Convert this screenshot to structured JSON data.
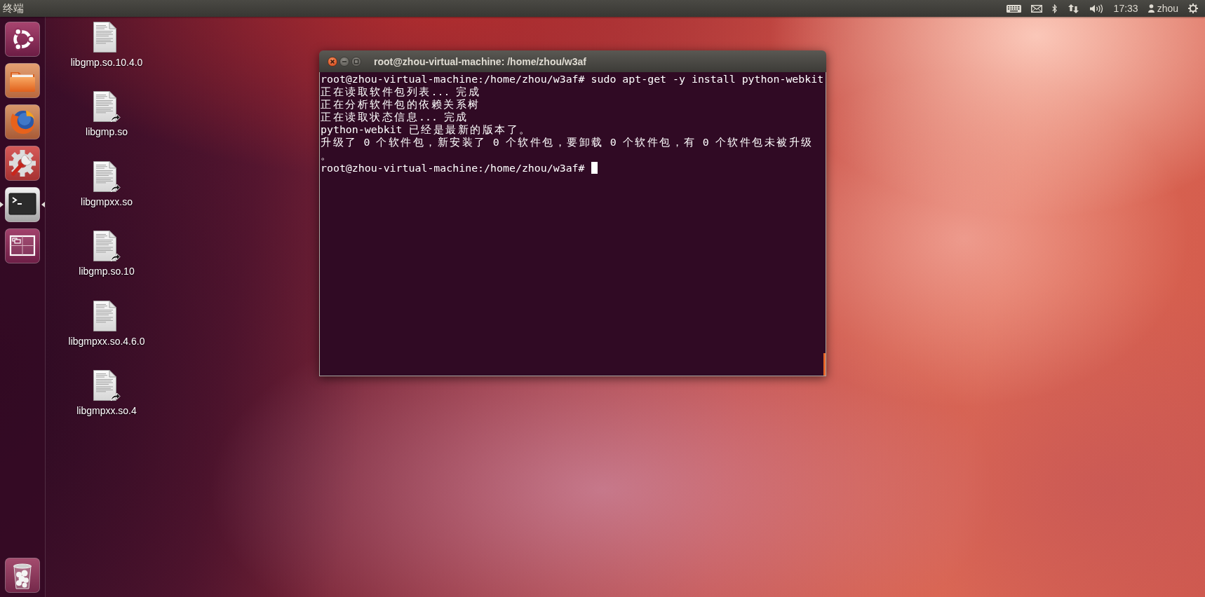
{
  "top_bar": {
    "title": "终端",
    "clock": "17:33",
    "user": "zhou"
  },
  "launcher": {
    "items": [
      {
        "kind": "dash",
        "running": false,
        "focused": false
      },
      {
        "kind": "files",
        "running": false,
        "focused": false
      },
      {
        "kind": "browser",
        "running": false,
        "focused": false
      },
      {
        "kind": "settings",
        "running": false,
        "focused": false
      },
      {
        "kind": "terminal",
        "running": true,
        "focused": true
      },
      {
        "kind": "workspaces",
        "running": false,
        "focused": false
      }
    ]
  },
  "desktop_icons": [
    {
      "label": "libgmp.so.10.4.0",
      "link": false
    },
    {
      "label": "libgmp.so",
      "link": true
    },
    {
      "label": "libgmpxx.so",
      "link": true
    },
    {
      "label": "libgmp.so.10",
      "link": true
    },
    {
      "label": "libgmpxx.so.4.6.0",
      "link": false
    },
    {
      "label": "libgmpxx.so.4",
      "link": true
    }
  ],
  "terminal": {
    "title": "root@zhou-virtual-machine: /home/zhou/w3af",
    "lines": [
      "root@zhou-virtual-machine:/home/zhou/w3af# sudo apt-get -y install python-webkit",
      "正在读取软件包列表... 完成",
      "正在分析软件包的依赖关系树",
      "正在读取状态信息... 完成",
      "python-webkit 已经是最新的版本了。",
      "升级了 0 个软件包，新安装了 0 个软件包，要卸载 0 个软件包，有 0 个软件包未被升级",
      "。",
      "root@zhou-virtual-machine:/home/zhou/w3af#"
    ],
    "cursor": true
  }
}
